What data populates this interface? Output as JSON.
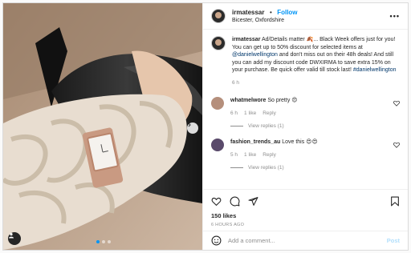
{
  "post": {
    "username": "irmatessar",
    "separator": "•",
    "follow_label": "Follow",
    "location": "Bicester, Oxfordshire",
    "more": "•••"
  },
  "caption": {
    "username": "irmatessar",
    "text_part1": "Ad/Details matter 🍂... Black Week offers just for you! You can get up to 50% discount for selected items at ",
    "mention": "@danielwellington",
    "text_part2": " and don't miss out on their 48h deals! And still you can add my discount code DWXIRMA to save extra 15% on your purchase. Be quick offer valid till stock last! ",
    "hashtag": "#danielwellington",
    "time": "6 h"
  },
  "comments": [
    {
      "username": "whatmelwore",
      "text": "So pretty 😍",
      "time": "6 h",
      "likes": "1 like",
      "reply": "Reply",
      "view_replies": "View replies (1)",
      "avatar_color": "#b58f7c"
    },
    {
      "username": "fashion_trends_au",
      "text": "Love this 😍😍",
      "time": "5 h",
      "likes": "1 like",
      "reply": "Reply",
      "view_replies": "View replies (1)",
      "avatar_color": "#5a4a6b"
    }
  ],
  "actions": {
    "likes": "150 likes",
    "date": "6 HOURS AGO"
  },
  "add_comment": {
    "placeholder": "Add a comment...",
    "post_label": "Post"
  },
  "colors": {
    "accent": "#0095f6",
    "muted": "#8e8e8e",
    "post_disabled": "#b2dffc"
  }
}
